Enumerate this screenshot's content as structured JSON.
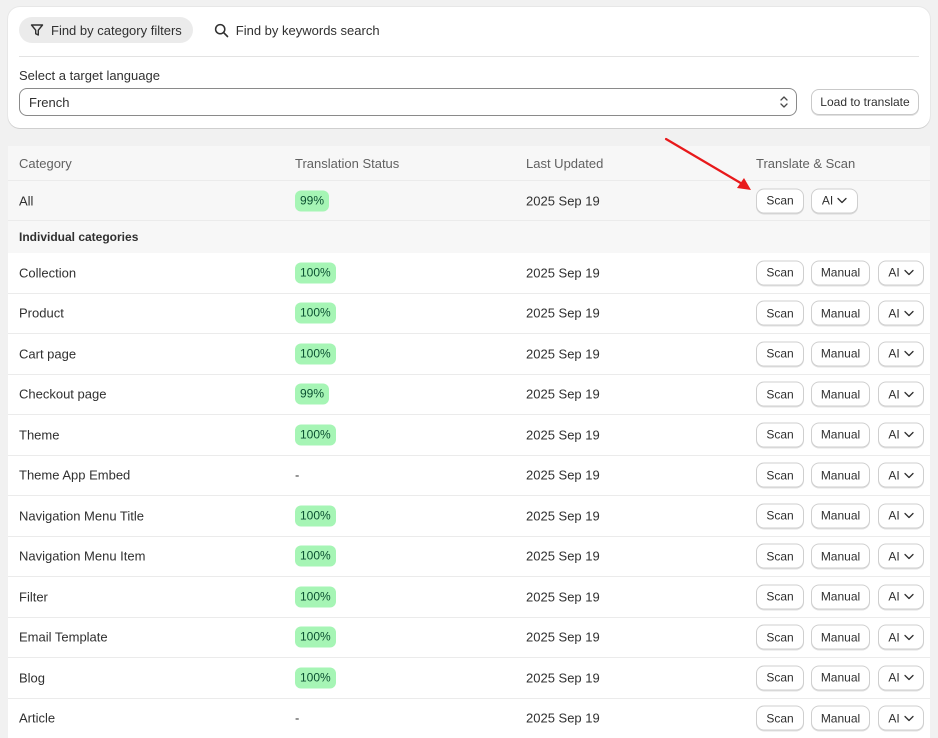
{
  "filters": {
    "tab_category": "Find by category filters",
    "tab_keywords": "Find by keywords search"
  },
  "language": {
    "label": "Select a target language",
    "value": "French",
    "load_button": "Load to translate"
  },
  "table": {
    "headers": [
      "Category",
      "Translation Status",
      "Last Updated",
      "Translate & Scan"
    ],
    "all_row": {
      "name": "All",
      "status": "99%",
      "date": "2025 Sep 19",
      "scan": "Scan",
      "ai": "AI"
    },
    "section_label": "Individual categories",
    "rows": [
      {
        "name": "Collection",
        "status": "100%",
        "date": "2025 Sep 19"
      },
      {
        "name": "Product",
        "status": "100%",
        "date": "2025 Sep 19"
      },
      {
        "name": "Cart page",
        "status": "100%",
        "date": "2025 Sep 19"
      },
      {
        "name": "Checkout page",
        "status": "99%",
        "date": "2025 Sep 19"
      },
      {
        "name": "Theme",
        "status": "100%",
        "date": "2025 Sep 19"
      },
      {
        "name": "Theme App Embed",
        "status": "-",
        "date": "2025 Sep 19"
      },
      {
        "name": "Navigation Menu Title",
        "status": "100%",
        "date": "2025 Sep 19"
      },
      {
        "name": "Navigation Menu Item",
        "status": "100%",
        "date": "2025 Sep 19"
      },
      {
        "name": "Filter",
        "status": "100%",
        "date": "2025 Sep 19"
      },
      {
        "name": "Email Template",
        "status": "100%",
        "date": "2025 Sep 19"
      },
      {
        "name": "Blog",
        "status": "100%",
        "date": "2025 Sep 19"
      },
      {
        "name": "Article",
        "status": "-",
        "date": "2025 Sep 19"
      }
    ],
    "buttons": {
      "scan": "Scan",
      "manual": "Manual",
      "ai": "AI"
    }
  },
  "colors": {
    "badge_bg": "#a6f5b5",
    "badge_text": "#0c5132",
    "annotation_arrow": "#e8191b"
  },
  "icons": {
    "category_tab": "filter-icon",
    "keywords_tab": "search-icon",
    "select": "select-updown-icon",
    "ai_dropdown": "chevron-down-icon"
  }
}
